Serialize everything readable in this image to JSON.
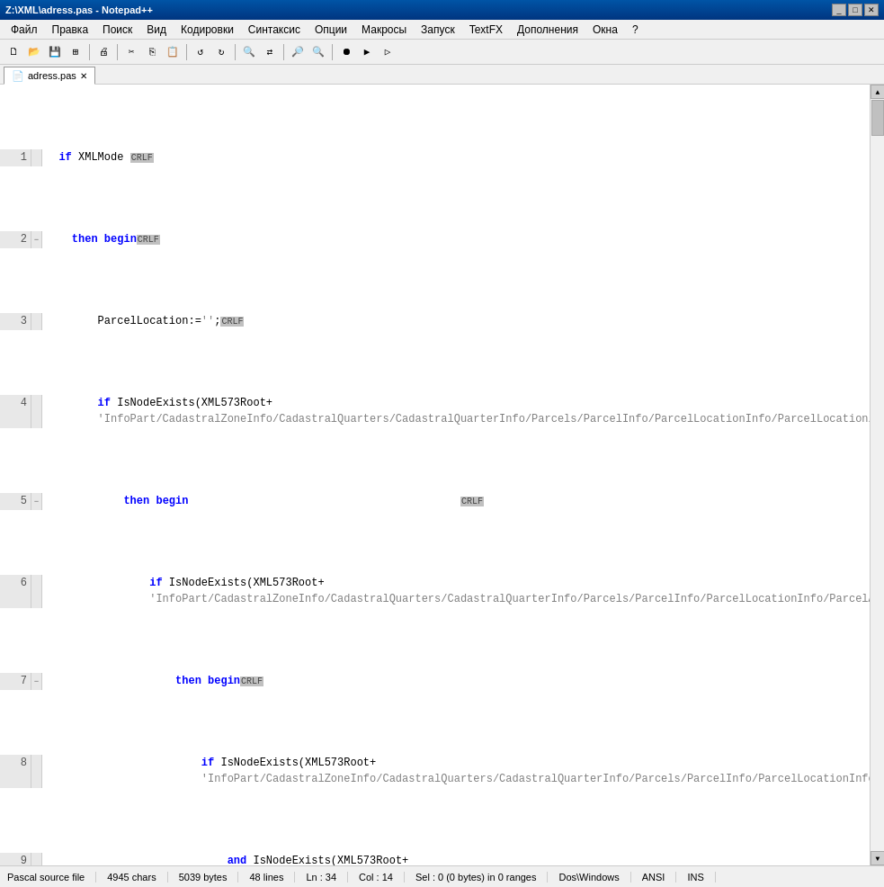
{
  "window": {
    "title": "Z:\\XML\\adress.pas - Notepad++",
    "titlebar_buttons": [
      "_",
      "□",
      "✕"
    ]
  },
  "menu": {
    "items": [
      "Файл",
      "Правка",
      "Поиск",
      "Вид",
      "Кодировки",
      "Синтаксис",
      "Опции",
      "Макросы",
      "Запуск",
      "TextFX",
      "Дополнения",
      "Окна",
      "?"
    ]
  },
  "tab": {
    "filename": "adress.pas"
  },
  "status": {
    "file_type": "Pascal source file",
    "chars": "4945 chars",
    "bytes": "5039 bytes",
    "lines": "48 lines",
    "ln": "Ln : 34",
    "col": "Col : 14",
    "sel": "Sel : 0 (0 bytes) in 0 ranges",
    "line_ending": "Dos\\Windows",
    "encoding": "ANSI",
    "ins": "INS"
  }
}
